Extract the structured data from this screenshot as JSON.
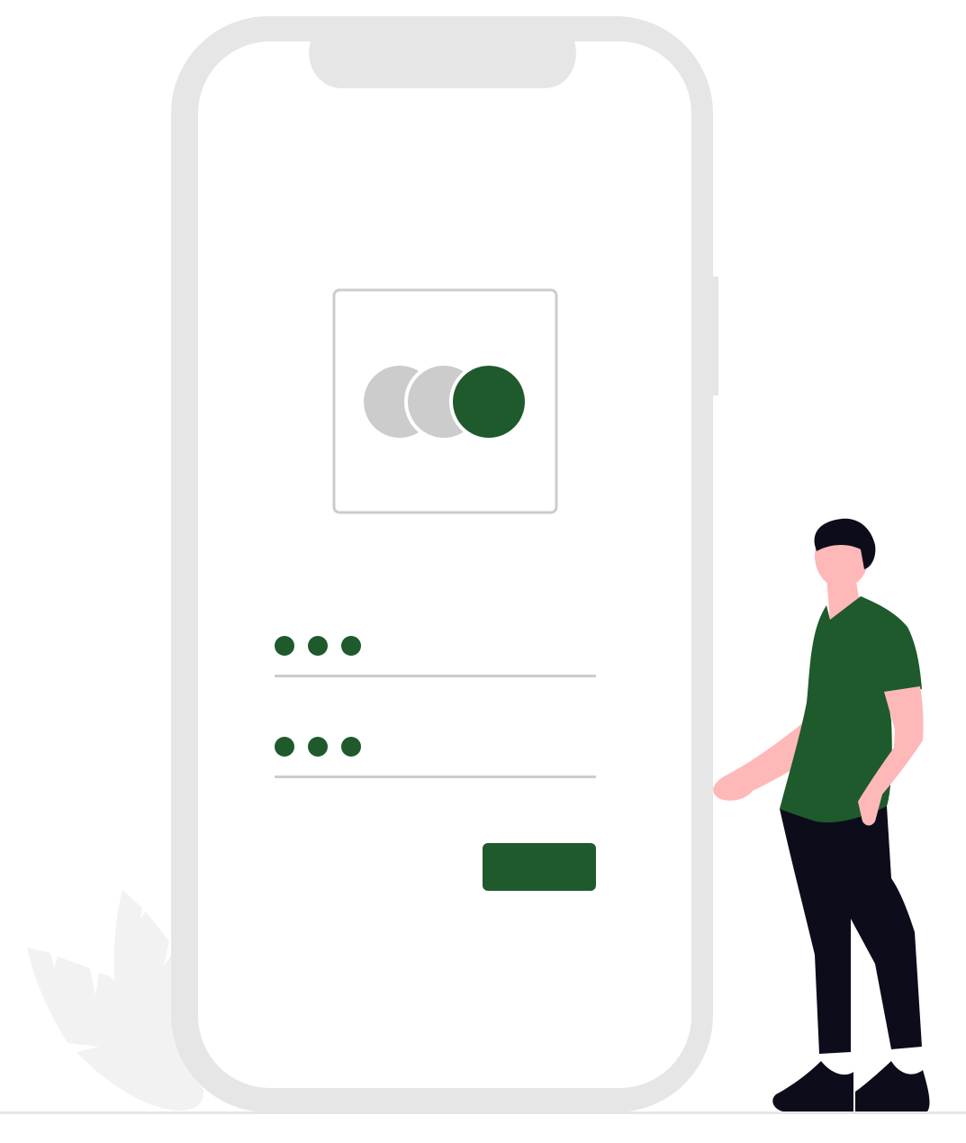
{
  "illustration": {
    "colors": {
      "phone_frame": "#e6e6e6",
      "screen": "#ffffff",
      "logo_border": "#cccccc",
      "logo_circle_gray": "#cccccc",
      "accent_green": "#1e5a2c",
      "input_line": "#cccccc",
      "leaf": "#f2f2f2",
      "ground": "#e6e6e6",
      "skin": "#ffb8b8",
      "hair": "#0d0c1a",
      "shirt": "#1e5a2c",
      "pants": "#0d0c1a",
      "shoes": "#0d0c1a"
    },
    "icons": {
      "logo": "three-overlapping-circles-icon",
      "password_dots": "masked-password-dots-icon"
    },
    "login_form": {
      "field_count": 2,
      "masked_dots_per_field": 3,
      "submit_button_label": ""
    }
  }
}
